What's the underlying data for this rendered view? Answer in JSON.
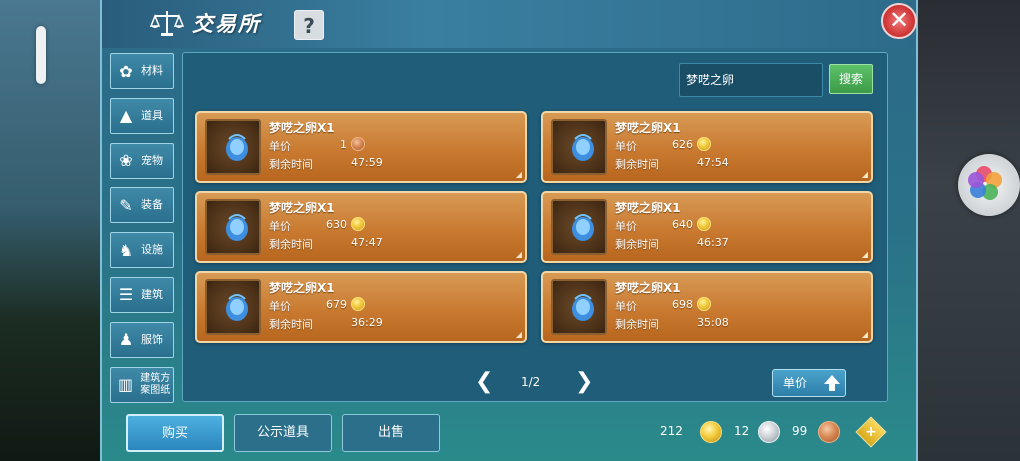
{
  "window": {
    "title": "交易所",
    "help_label": "?",
    "close_label": "✕"
  },
  "sidebar": {
    "items": [
      {
        "label": "材料",
        "icon": "materials-icon"
      },
      {
        "label": "道具",
        "icon": "flask-icon"
      },
      {
        "label": "宠物",
        "icon": "paw-icon"
      },
      {
        "label": "装备",
        "icon": "sword-icon"
      },
      {
        "label": "设施",
        "icon": "facility-icon"
      },
      {
        "label": "建筑",
        "icon": "building-icon"
      },
      {
        "label": "服饰",
        "icon": "clothing-icon"
      },
      {
        "label": "建筑方案图纸",
        "icon": "blueprint-icon"
      }
    ]
  },
  "search": {
    "value": "梦呓之卵",
    "button_label": "搜索"
  },
  "listing_labels": {
    "price": "单价",
    "time": "剩余时间"
  },
  "listings": [
    {
      "name": "梦呓之卵X1",
      "price": "1",
      "currency": "copper",
      "time": "47:59"
    },
    {
      "name": "梦呓之卵X1",
      "price": "626",
      "currency": "gold",
      "time": "47:54"
    },
    {
      "name": "梦呓之卵X1",
      "price": "630",
      "currency": "gold",
      "time": "47:47"
    },
    {
      "name": "梦呓之卵X1",
      "price": "640",
      "currency": "gold",
      "time": "46:37"
    },
    {
      "name": "梦呓之卵X1",
      "price": "679",
      "currency": "gold",
      "time": "36:29"
    },
    {
      "name": "梦呓之卵X1",
      "price": "698",
      "currency": "gold",
      "time": "35:08"
    }
  ],
  "pagination": {
    "prev": "❮",
    "next": "❯",
    "text": "1/2"
  },
  "sort": {
    "label": "单价"
  },
  "bottom_bar": {
    "buy_label": "购买",
    "public_label": "公示道具",
    "sell_label": "出售"
  },
  "currencies": {
    "gold": "212",
    "silver": "12",
    "copper": "99",
    "add_label": "+"
  },
  "colors": {
    "card_top": "#d89a55",
    "card_bottom": "#b8661f",
    "accent_blue": "#2b86bd",
    "search_green": "#3c9b48",
    "close_red": "#d23a3a"
  }
}
